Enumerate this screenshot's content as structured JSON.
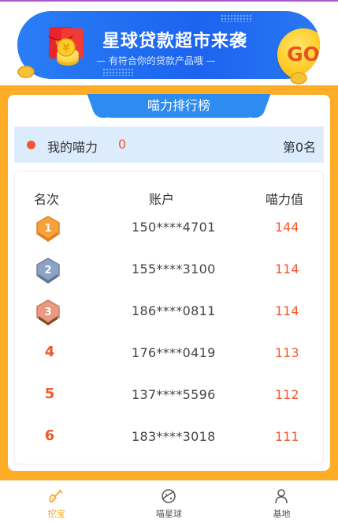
{
  "banner": {
    "title": "星球贷款超市来袭",
    "subtitle": "— 有符合你的贷款产品哦 —",
    "go_label": "GO"
  },
  "ranking": {
    "tab_title": "喵力排行榜",
    "my_power_label": "我的喵力",
    "my_power_value": "0",
    "my_rank": "第0名",
    "headers": {
      "rank": "名次",
      "account": "账户",
      "power": "喵力值"
    },
    "rows": [
      {
        "rank": "1",
        "account": "150****4701",
        "score": "144",
        "medal": "gold"
      },
      {
        "rank": "2",
        "account": "155****3100",
        "score": "114",
        "medal": "silver"
      },
      {
        "rank": "3",
        "account": "186****0811",
        "score": "114",
        "medal": "bronze"
      },
      {
        "rank": "4",
        "account": "176****0419",
        "score": "113"
      },
      {
        "rank": "5",
        "account": "137****5596",
        "score": "112"
      },
      {
        "rank": "6",
        "account": "183****3018",
        "score": "111"
      }
    ]
  },
  "nav": {
    "items": [
      {
        "label": "挖宝",
        "icon": "shovel-icon",
        "active": true
      },
      {
        "label": "喵星球",
        "icon": "planet-icon",
        "active": false
      },
      {
        "label": "基地",
        "icon": "person-icon",
        "active": false
      }
    ]
  },
  "colors": {
    "accent_orange": "#ffad27",
    "primary_blue": "#2d8cf0",
    "value_red": "#f1582a",
    "active_nav": "#f7a51c"
  }
}
